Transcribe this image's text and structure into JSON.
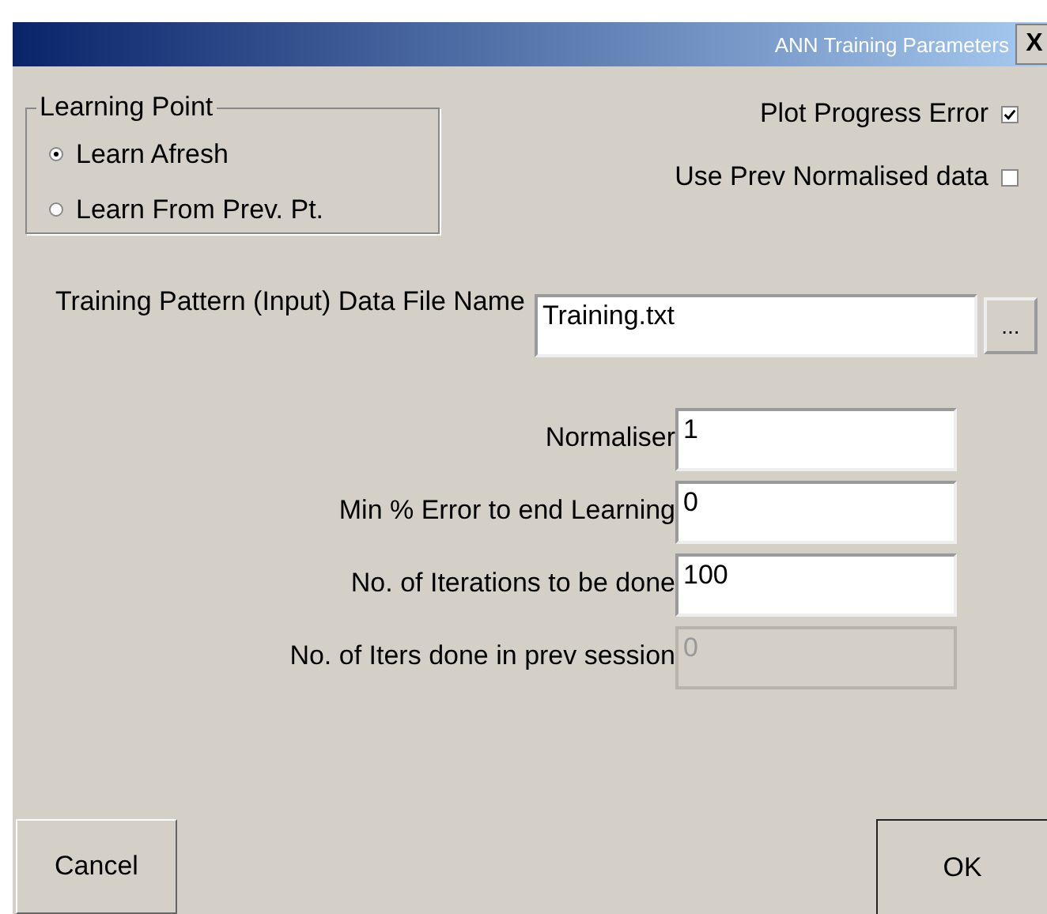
{
  "window": {
    "title": "ANN Training Parameters",
    "close": "X"
  },
  "learning_point": {
    "label": "Learning Point",
    "options": [
      {
        "label": "Learn Afresh",
        "selected": true
      },
      {
        "label": "Learn From Prev. Pt.",
        "selected": false
      }
    ]
  },
  "checkboxes": [
    {
      "label": "Plot Progress Error",
      "checked": true
    },
    {
      "label": "Use Prev Normalised data",
      "checked": false
    }
  ],
  "file": {
    "label": "Training Pattern (Input) Data File Name",
    "value": "Training.txt",
    "browse": "..."
  },
  "fields": [
    {
      "label": "Normaliser",
      "value": "1",
      "disabled": false
    },
    {
      "label": "Min % Error to end Learning",
      "value": "0",
      "disabled": false
    },
    {
      "label": "No. of Iterations to be done",
      "value": "100",
      "disabled": false
    },
    {
      "label": "No. of Iters done in prev session",
      "value": "0",
      "disabled": true
    }
  ],
  "buttons": {
    "cancel": "Cancel",
    "ok": "OK"
  }
}
